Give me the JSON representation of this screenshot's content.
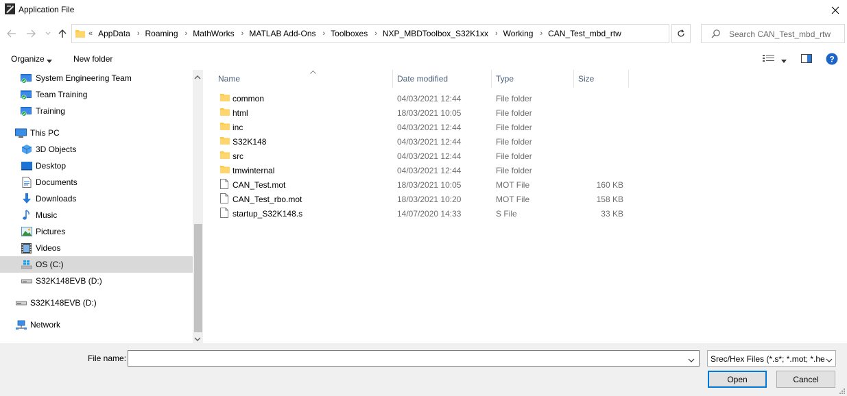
{
  "window": {
    "title": "Application File"
  },
  "address": {
    "overflow_chevron": "«",
    "crumbs": [
      "AppData",
      "Roaming",
      "MathWorks",
      "MATLAB Add-Ons",
      "Toolboxes",
      "NXP_MBDToolbox_S32K1xx",
      "Working",
      "CAN_Test_mbd_rtw"
    ]
  },
  "search": {
    "placeholder": "Search CAN_Test_mbd_rtw"
  },
  "toolbar": {
    "organize_label": "Organize",
    "new_folder_label": "New folder"
  },
  "nav": {
    "items": [
      {
        "label": "System Engineering Team",
        "icon": "sharepoint-folder-icon"
      },
      {
        "label": "Team Training",
        "icon": "sharepoint-folder-icon"
      },
      {
        "label": "Training",
        "icon": "sharepoint-folder-icon"
      },
      {
        "label": "This PC",
        "icon": "computer-icon"
      },
      {
        "label": "3D Objects",
        "icon": "cube-icon"
      },
      {
        "label": "Desktop",
        "icon": "desktop-icon"
      },
      {
        "label": "Documents",
        "icon": "documents-icon"
      },
      {
        "label": "Downloads",
        "icon": "download-arrow-icon"
      },
      {
        "label": "Music",
        "icon": "music-note-icon"
      },
      {
        "label": "Pictures",
        "icon": "pictures-icon"
      },
      {
        "label": "Videos",
        "icon": "film-icon"
      },
      {
        "label": "OS (C:)",
        "icon": "windows-drive-icon"
      },
      {
        "label": "S32K148EVB (D:)",
        "icon": "removable-drive-icon"
      },
      {
        "label": "S32K148EVB (D:)",
        "icon": "removable-drive-icon"
      },
      {
        "label": "Network",
        "icon": "network-icon"
      }
    ]
  },
  "columns": {
    "name": "Name",
    "date": "Date modified",
    "type": "Type",
    "size": "Size"
  },
  "files": [
    {
      "name": "common",
      "date": "04/03/2021 12:44",
      "type": "File folder",
      "size": "",
      "kind": "folder"
    },
    {
      "name": "html",
      "date": "18/03/2021 10:05",
      "type": "File folder",
      "size": "",
      "kind": "folder"
    },
    {
      "name": "inc",
      "date": "04/03/2021 12:44",
      "type": "File folder",
      "size": "",
      "kind": "folder"
    },
    {
      "name": "S32K148",
      "date": "04/03/2021 12:44",
      "type": "File folder",
      "size": "",
      "kind": "folder"
    },
    {
      "name": "src",
      "date": "04/03/2021 12:44",
      "type": "File folder",
      "size": "",
      "kind": "folder"
    },
    {
      "name": "tmwinternal",
      "date": "04/03/2021 12:44",
      "type": "File folder",
      "size": "",
      "kind": "folder"
    },
    {
      "name": "CAN_Test.mot",
      "date": "18/03/2021 10:05",
      "type": "MOT File",
      "size": "160 KB",
      "kind": "file"
    },
    {
      "name": "CAN_Test_rbo.mot",
      "date": "18/03/2021 10:20",
      "type": "MOT File",
      "size": "158 KB",
      "kind": "file"
    },
    {
      "name": "startup_S32K148.s",
      "date": "14/07/2020 14:33",
      "type": "S File",
      "size": "33 KB",
      "kind": "file"
    }
  ],
  "bottom": {
    "file_name_label": "File name:",
    "file_name_value": "",
    "filter_value": "Srec/Hex Files (*.s*; *.mot; *.hex)",
    "open_label": "Open",
    "cancel_label": "Cancel"
  },
  "colors": {
    "accent": "#0078d7",
    "folder": "#ffc83d",
    "selected_nav": "#d9d9d9",
    "header_text": "#4c607a"
  }
}
